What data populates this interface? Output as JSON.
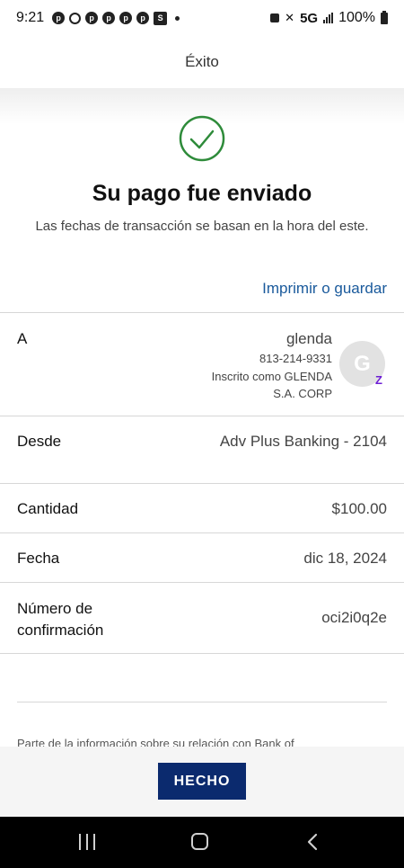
{
  "status_bar": {
    "time": "9:21",
    "network": "5G",
    "battery": "100%"
  },
  "header": {
    "title": "Éxito"
  },
  "success": {
    "title": "Su pago fue enviado",
    "subtitle": "Las fechas de transacción se basan en la hora del este.",
    "print_link": "Imprimir o guardar"
  },
  "details": {
    "to_label": "A",
    "to_name": "glenda",
    "to_phone": "813-214-9331",
    "to_registered_line1": "Inscrito como GLENDA",
    "to_registered_line2": "S.A. CORP",
    "avatar_initial": "G",
    "zelle_badge": "Z",
    "from_label": "Desde",
    "from_value": "Adv Plus Banking - 2104",
    "amount_label": "Cantidad",
    "amount_value": "$100.00",
    "date_label": "Fecha",
    "date_value": "dic 18, 2024",
    "confirmation_label_line1": "Número de",
    "confirmation_label_line2": "confirmación",
    "confirmation_value": "oci2i0q2e"
  },
  "disclaimer": "Parte de la información sobre su relación con Bank of",
  "footer": {
    "done_label": "HECHO"
  },
  "colors": {
    "success_green": "#2e8b3a",
    "link_blue": "#1a5a9c",
    "button_navy": "#0b2a6e",
    "zelle_purple": "#6d1ed4"
  }
}
